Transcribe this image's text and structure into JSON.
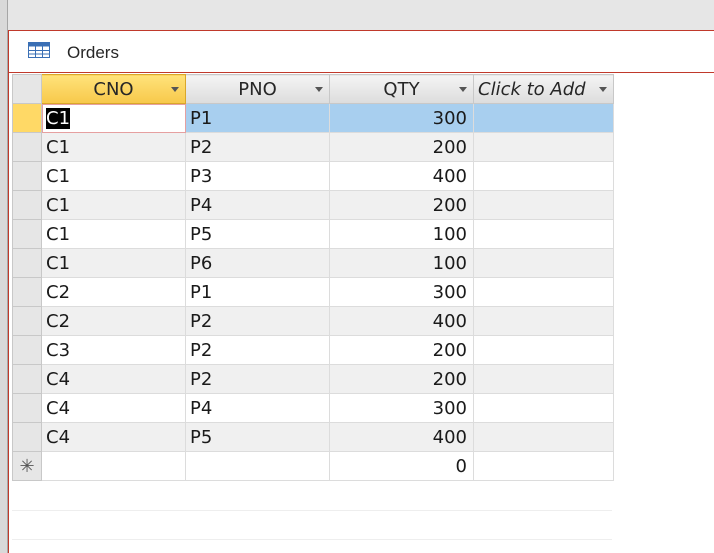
{
  "window": {
    "tab_title": "Orders",
    "tab_icon": "datasheet-table-icon"
  },
  "grid": {
    "columns": [
      {
        "key": "cno",
        "label": "CNO",
        "active": true
      },
      {
        "key": "pno",
        "label": "PNO",
        "active": false
      },
      {
        "key": "qty",
        "label": "QTY",
        "active": false
      },
      {
        "key": "add",
        "label": "Click to Add",
        "active": false
      }
    ],
    "rows": [
      {
        "cno": "C1",
        "pno": "P1",
        "qty": "300"
      },
      {
        "cno": "C1",
        "pno": "P2",
        "qty": "200"
      },
      {
        "cno": "C1",
        "pno": "P3",
        "qty": "400"
      },
      {
        "cno": "C1",
        "pno": "P4",
        "qty": "200"
      },
      {
        "cno": "C1",
        "pno": "P5",
        "qty": "100"
      },
      {
        "cno": "C1",
        "pno": "P6",
        "qty": "100"
      },
      {
        "cno": "C2",
        "pno": "P1",
        "qty": "300"
      },
      {
        "cno": "C2",
        "pno": "P2",
        "qty": "400"
      },
      {
        "cno": "C3",
        "pno": "P2",
        "qty": "200"
      },
      {
        "cno": "C4",
        "pno": "P2",
        "qty": "200"
      },
      {
        "cno": "C4",
        "pno": "P4",
        "qty": "300"
      },
      {
        "cno": "C4",
        "pno": "P5",
        "qty": "400"
      }
    ],
    "new_row": {
      "marker": "✳",
      "qty_default": "0"
    },
    "current_row_index": 0,
    "colors": {
      "active_header": "#f7c84a",
      "selected_row": "#a8cfef",
      "alternate_row": "#f0f0f0"
    }
  }
}
